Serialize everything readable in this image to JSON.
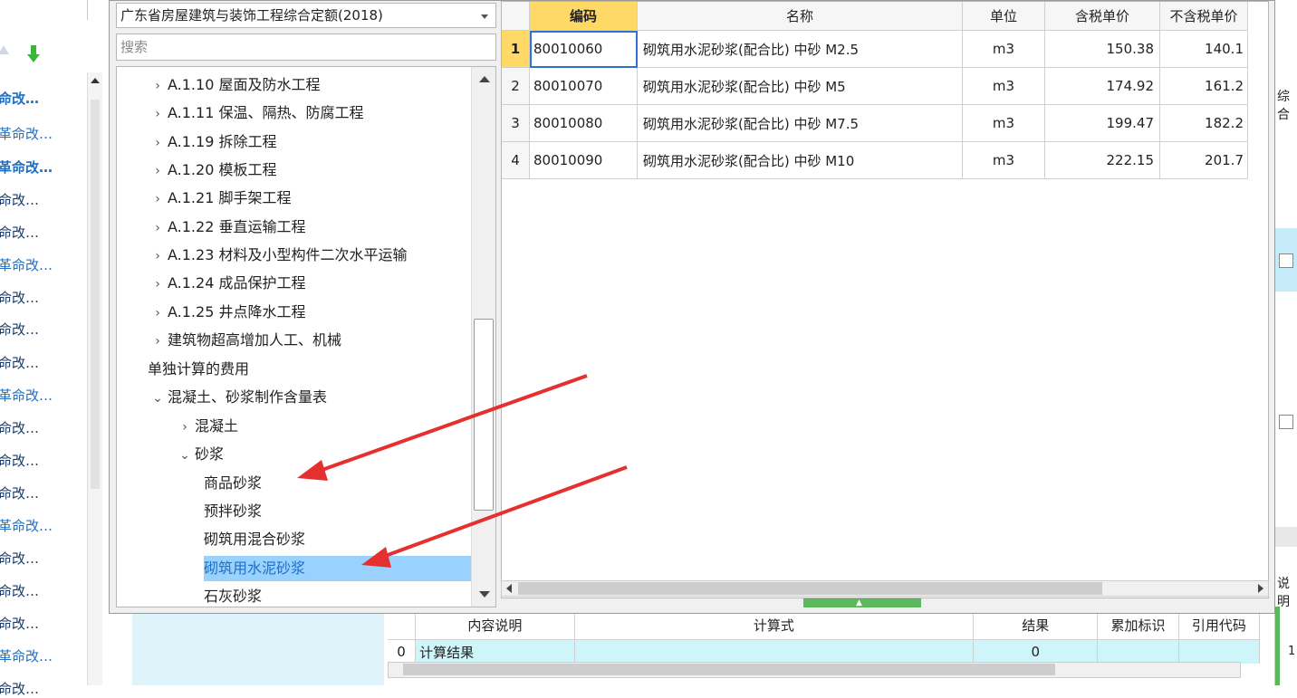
{
  "left_list": {
    "items": [
      {
        "text": "命改…",
        "style": "bold"
      },
      {
        "text": "革命改…",
        "style": "blue"
      },
      {
        "text": "革命改…",
        "style": "bold"
      },
      {
        "text": "命改…",
        "style": "normal"
      },
      {
        "text": "命改…",
        "style": "normal"
      },
      {
        "text": "革命改…",
        "style": "blue"
      },
      {
        "text": "命改…",
        "style": "normal"
      },
      {
        "text": "命改…",
        "style": "normal"
      },
      {
        "text": "命改…",
        "style": "normal"
      },
      {
        "text": "革命改…",
        "style": "blue"
      },
      {
        "text": "命改…",
        "style": "normal"
      },
      {
        "text": "命改…",
        "style": "normal"
      },
      {
        "text": "命改…",
        "style": "normal"
      },
      {
        "text": "革命改…",
        "style": "blue"
      },
      {
        "text": "命改…",
        "style": "normal"
      },
      {
        "text": "命改…",
        "style": "normal"
      },
      {
        "text": "命改…",
        "style": "normal"
      },
      {
        "text": "革命改…",
        "style": "blue"
      },
      {
        "text": "命改…",
        "style": "normal"
      }
    ]
  },
  "dialog": {
    "quota_select": "广东省房屋建筑与装饰工程综合定额(2018)",
    "search_placeholder": "搜索",
    "tree": [
      {
        "label": "A.1.10 屋面及防水工程",
        "level": 1,
        "caret": ">"
      },
      {
        "label": "A.1.11 保温、隔热、防腐工程",
        "level": 1,
        "caret": ">"
      },
      {
        "label": "A.1.19 拆除工程",
        "level": 1,
        "caret": ">"
      },
      {
        "label": "A.1.20 模板工程",
        "level": 1,
        "caret": ">"
      },
      {
        "label": "A.1.21 脚手架工程",
        "level": 1,
        "caret": ">"
      },
      {
        "label": "A.1.22 垂直运输工程",
        "level": 1,
        "caret": ">"
      },
      {
        "label": "A.1.23 材料及小型构件二次水平运输",
        "level": 1,
        "caret": ">"
      },
      {
        "label": "A.1.24 成品保护工程",
        "level": 1,
        "caret": ">"
      },
      {
        "label": "A.1.25 井点降水工程",
        "level": 1,
        "caret": ">"
      },
      {
        "label": "建筑物超高增加人工、机械",
        "level": 1,
        "caret": ">"
      },
      {
        "label": "单独计算的费用",
        "level": 1,
        "caret": ""
      },
      {
        "label": "混凝土、砂浆制作含量表",
        "level": 1,
        "caret": "v"
      },
      {
        "label": "混凝土",
        "level": 2,
        "caret": ">"
      },
      {
        "label": "砂浆",
        "level": 2,
        "caret": "v"
      },
      {
        "label": "商品砂浆",
        "level": 3,
        "caret": ""
      },
      {
        "label": "预拌砂浆",
        "level": 3,
        "caret": ""
      },
      {
        "label": "砌筑用混合砂浆",
        "level": 3,
        "caret": ""
      },
      {
        "label": "砌筑用水泥砂浆",
        "level": 3,
        "caret": "",
        "selected": true
      },
      {
        "label": "石灰砂浆",
        "level": 3,
        "caret": ""
      }
    ],
    "grid": {
      "headers": {
        "code": "编码",
        "name": "名称",
        "unit": "单位",
        "price_tax": "含税单价",
        "price_notax": "不含税单价"
      },
      "rows": [
        {
          "idx": "1",
          "code": "80010060",
          "name": "砌筑用水泥砂浆(配合比) 中砂 M2.5",
          "unit": "m3",
          "price_tax": "150.38",
          "price_notax": "140.1"
        },
        {
          "idx": "2",
          "code": "80010070",
          "name": "砌筑用水泥砂浆(配合比) 中砂 M5",
          "unit": "m3",
          "price_tax": "174.92",
          "price_notax": "161.2"
        },
        {
          "idx": "3",
          "code": "80010080",
          "name": "砌筑用水泥砂浆(配合比) 中砂 M7.5",
          "unit": "m3",
          "price_tax": "199.47",
          "price_notax": "182.2"
        },
        {
          "idx": "4",
          "code": "80010090",
          "name": "砌筑用水泥砂浆(配合比) 中砂 M10",
          "unit": "m3",
          "price_tax": "222.15",
          "price_notax": "201.7"
        }
      ]
    }
  },
  "calc_panel": {
    "headers": {
      "desc": "内容说明",
      "formula": "计算式",
      "result": "结果",
      "accum": "累加标识",
      "ref": "引用代码"
    },
    "row": {
      "idx": "0",
      "desc": "计算结果",
      "formula": "",
      "result": "0"
    }
  },
  "right_strip": {
    "t1": "综合",
    "t2": "说明",
    "t3": "1"
  },
  "colors": {
    "accent_blue": "#1f6fc4",
    "highlight_yellow": "#ffd966",
    "selected_row": "#99d1ff",
    "arrow_red": "#e53030",
    "splitter_green": "#5cb85c"
  }
}
